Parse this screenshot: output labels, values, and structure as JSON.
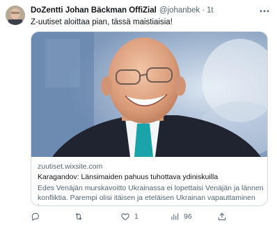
{
  "tweet": {
    "author_name": "DoZentti Johan Bäckman OffiZial",
    "author_handle": "@johanbek",
    "separator": "·",
    "timestamp": "1t",
    "text": "Z-uutiset aloittaa pian, tässä maistiaisia!"
  },
  "card": {
    "domain": "zuutiset.wixsite.com",
    "title": "Karagandov: Länsimaiden pahuus tuhottava ydiniskuilla",
    "description": "Edes Venäjän murskavoitto Ukrainassa ei lopettaisi Venäjän ja lännen konfliktia. Parempi olisi itäisen ja eteläisen Ukrainan vapauttaminen j..."
  },
  "actions": {
    "reply_count": "",
    "retweet_count": "",
    "like_count": "1",
    "views_count": "96"
  },
  "icons": {
    "more": "more-dots-icon",
    "reply": "reply-icon",
    "retweet": "retweet-icon",
    "like": "heart-icon",
    "views": "views-chart-icon",
    "share": "share-icon"
  },
  "colors": {
    "text": "#0f1419",
    "secondary": "#536471",
    "border": "#cfd9de"
  }
}
